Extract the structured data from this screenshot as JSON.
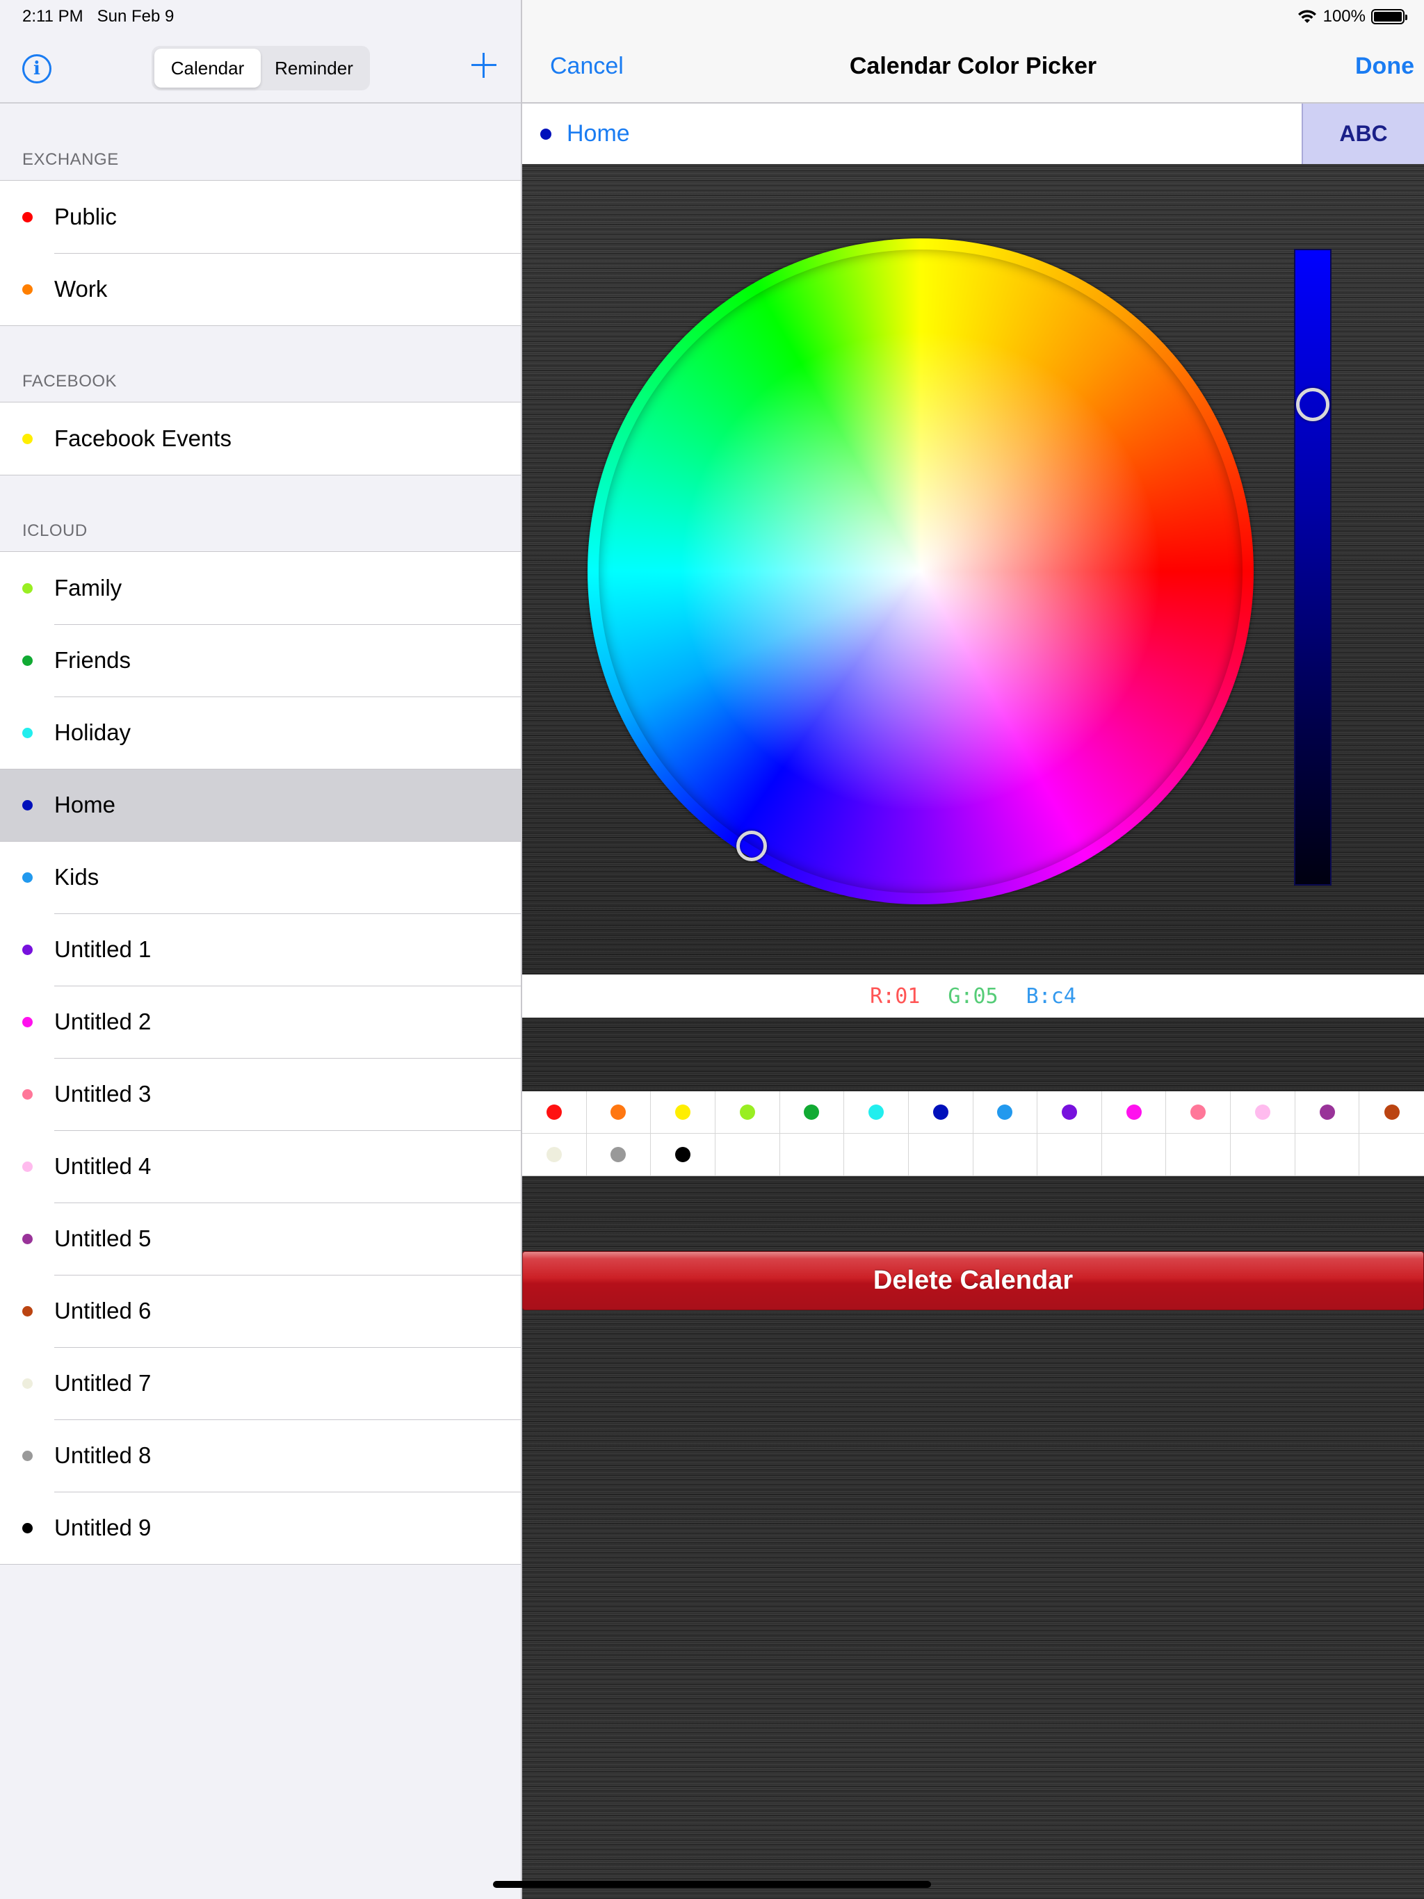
{
  "status_bar": {
    "time": "2:11 PM",
    "date": "Sun Feb 9",
    "battery": "100%",
    "battery_level": 1.0
  },
  "left_nav": {
    "info_icon": "info-icon",
    "segments": [
      {
        "label": "Calendar",
        "selected": true
      },
      {
        "label": "Reminder",
        "selected": false
      }
    ],
    "add_icon": "plus-icon"
  },
  "sections": [
    {
      "header": "EXCHANGE",
      "items": [
        {
          "label": "Public",
          "color": "#ff0000"
        },
        {
          "label": "Work",
          "color": "#ff7f00"
        }
      ]
    },
    {
      "header": "FACEBOOK",
      "items": [
        {
          "label": "Facebook Events",
          "color": "#ffee00"
        }
      ]
    },
    {
      "header": "ICLOUD",
      "items": [
        {
          "label": "Family",
          "color": "#99ee22"
        },
        {
          "label": "Friends",
          "color": "#11aa33"
        },
        {
          "label": "Holiday",
          "color": "#22eeee"
        },
        {
          "label": "Home",
          "color": "#0010bb",
          "selected": true
        },
        {
          "label": "Kids",
          "color": "#2299ee"
        },
        {
          "label": "Untitled 1",
          "color": "#7711dd"
        },
        {
          "label": "Untitled 2",
          "color": "#ff11ee"
        },
        {
          "label": "Untitled 3",
          "color": "#ff7799"
        },
        {
          "label": "Untitled 4",
          "color": "#ffbbee"
        },
        {
          "label": "Untitled 5",
          "color": "#993399"
        },
        {
          "label": "Untitled 6",
          "color": "#bb4411"
        },
        {
          "label": "Untitled 7",
          "color": "#eeeedd"
        },
        {
          "label": "Untitled 8",
          "color": "#999999"
        },
        {
          "label": "Untitled 9",
          "color": "#000000"
        }
      ]
    }
  ],
  "right_nav": {
    "cancel": "Cancel",
    "title": "Calendar Color Picker",
    "done": "Done"
  },
  "calendar_name": {
    "text": "Home",
    "color": "#0010bb",
    "abc_button": "ABC"
  },
  "rgb": {
    "r": "R:01",
    "g": "G:05",
    "b": "B:c4",
    "r_color": "#ff5555",
    "g_color": "#55cc77",
    "b_color": "#3399ee"
  },
  "brightness": {
    "level": 0.76,
    "color": "#0000ff"
  },
  "swatches": [
    "#ff1111",
    "#ff7711",
    "#ffee00",
    "#99ee22",
    "#11aa33",
    "#22eeee",
    "#0010bb",
    "#2299ee",
    "#7711dd",
    "#ff11ee",
    "#ff7799",
    "#ffbbee",
    "#993399",
    "#bb4411",
    "#eeeedd",
    "#999999",
    "#000000"
  ],
  "delete_button": "Delete Calendar"
}
